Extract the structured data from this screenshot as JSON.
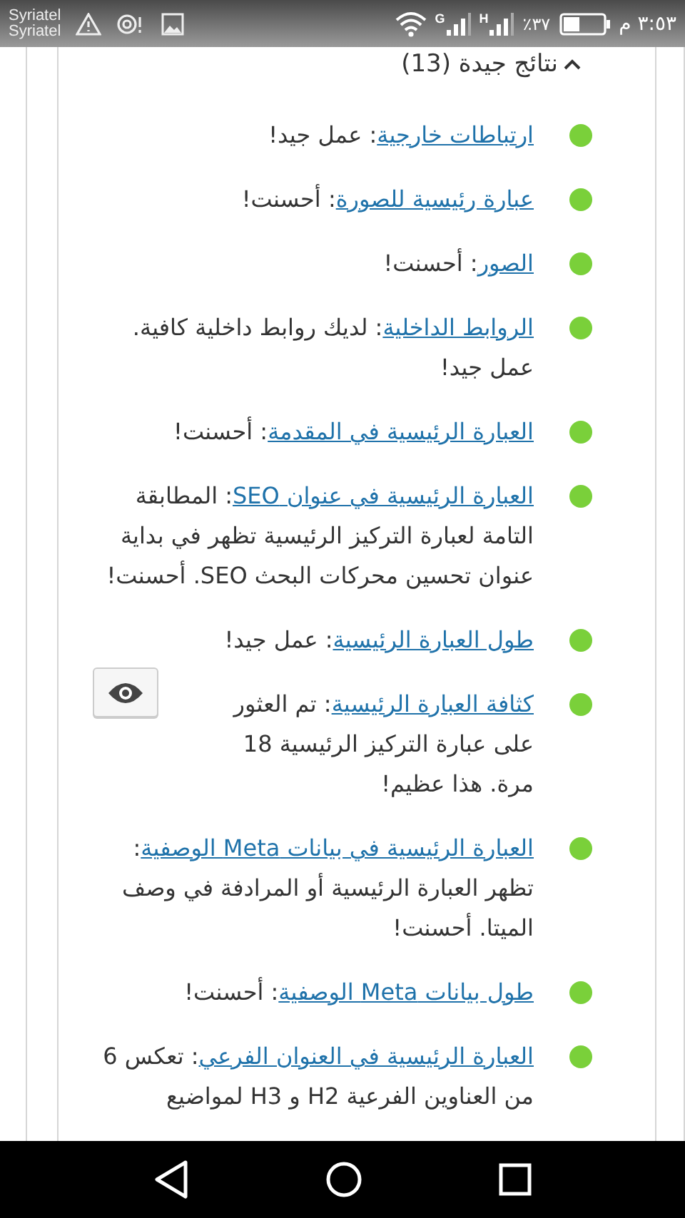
{
  "status_bar": {
    "carriers": [
      "Syriatel",
      "Syriatel"
    ],
    "network_labels": [
      "H",
      "G"
    ],
    "battery": "٪٣٧",
    "time": "٣:٥٣ م"
  },
  "section": {
    "title": "نتائج جيدة (13)",
    "expanded": true,
    "items": [
      {
        "kind": "plain",
        "color": "#7ad03a",
        "link": "ارتباطات خارجية",
        "text": ": عمل جيد!"
      },
      {
        "kind": "plain",
        "color": "#7ad03a",
        "link": "عبارة رئيسية للصورة",
        "text": ": أحسنت!"
      },
      {
        "kind": "plain",
        "color": "#7ad03a",
        "link": "الصور",
        "text": ": أحسنت!"
      },
      {
        "kind": "plain",
        "color": "#7ad03a",
        "link": "الروابط الداخلية",
        "text": ": لديك روابط داخلية كافية. عمل جيد!"
      },
      {
        "kind": "plain",
        "color": "#7ad03a",
        "link": "العبارة الرئيسية في المقدمة",
        "text": ": أحسنت!"
      },
      {
        "kind": "plain",
        "color": "#7ad03a",
        "link": "العبارة الرئيسية في عنوان SEO",
        "text": ": المطابقة التامة لعبارة التركيز الرئيسية تظهر في بداية عنوان تحسين محركات البحث SEO. أحسنت!"
      },
      {
        "kind": "plain",
        "color": "#7ad03a",
        "link": "طول العبارة الرئيسية",
        "text": ": عمل جيد!"
      },
      {
        "kind": "preview",
        "color": "#7ad03a",
        "link": "كثافة العبارة الرئيسية",
        "text": ": تم العثور على عبارة التركيز الرئيسية 18 مرة. هذا عظيم!"
      },
      {
        "kind": "plain",
        "color": "#7ad03a",
        "link": "العبارة الرئيسية في بيانات Meta الوصفية",
        "text": ": تظهر العبارة الرئيسية أو المرادفة في وصف الميتا. أحسنت!"
      },
      {
        "kind": "plain",
        "color": "#7ad03a",
        "link": "طول بيانات Meta الوصفية",
        "text": ": أحسنت!"
      },
      {
        "kind": "plain",
        "color": "#7ad03a",
        "link": "العبارة الرئيسية في العنوان الفرعي",
        "text": ": تعكس 6 من العناوين الفرعية H2 و H3 لمواضيع"
      }
    ]
  }
}
